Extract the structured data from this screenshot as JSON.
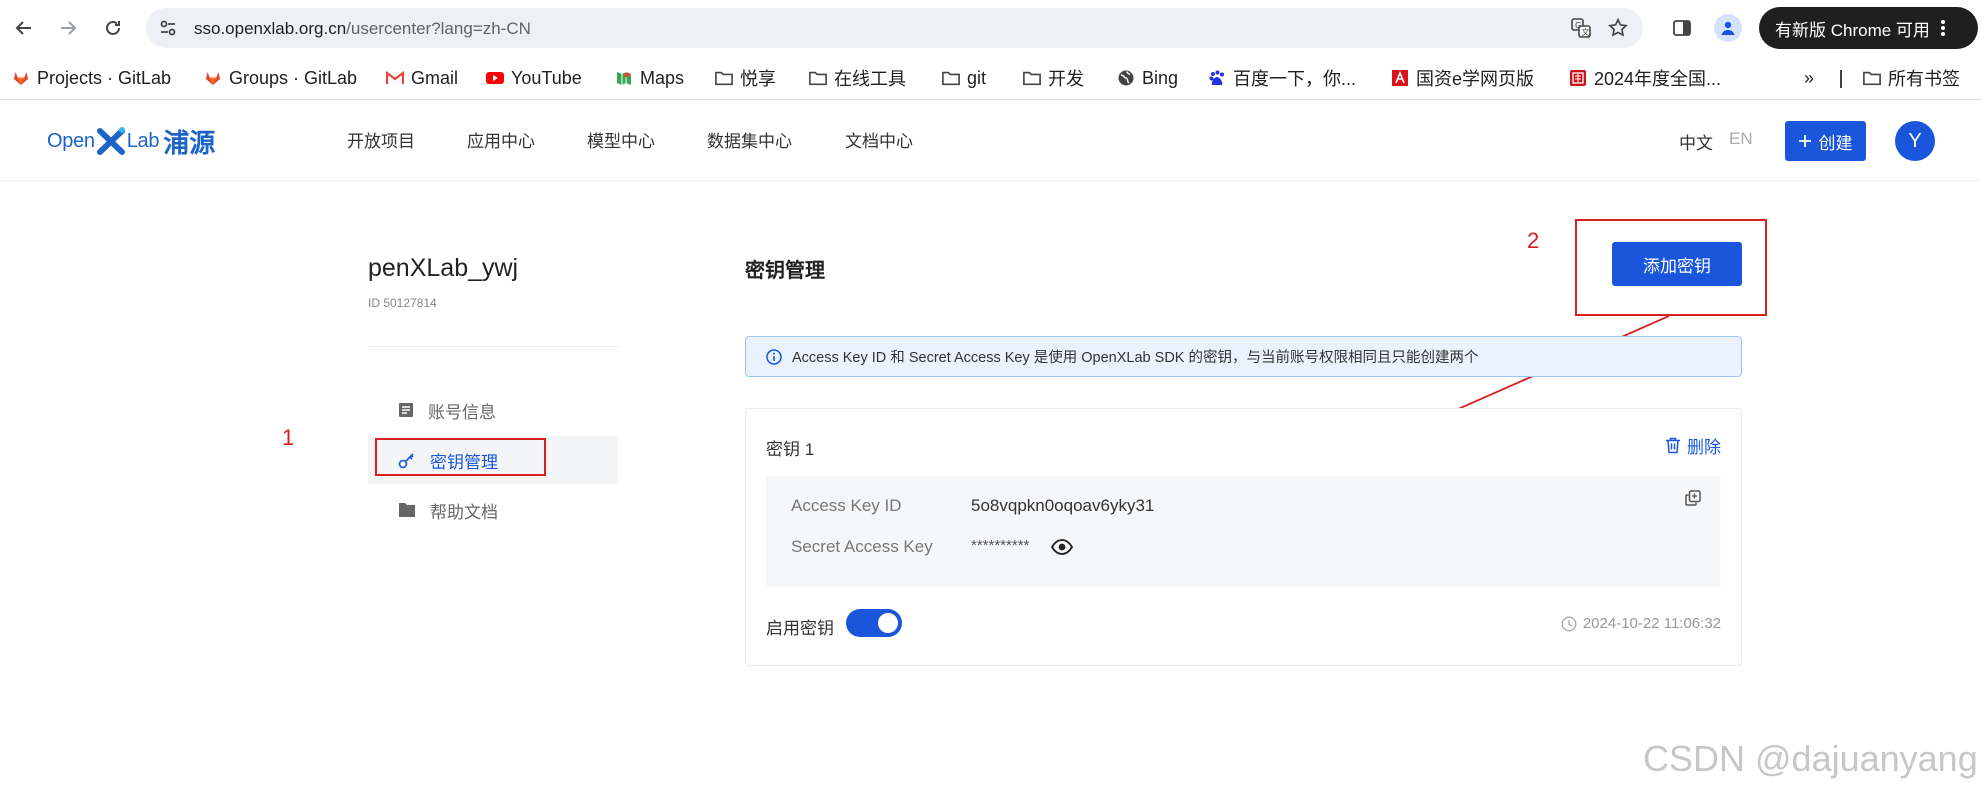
{
  "browser": {
    "url_host": "sso.openxlab.org.cn",
    "url_path": "/usercenter?lang=zh-CN",
    "update_button": "有新版 Chrome 可用",
    "bookmarks": [
      {
        "label": "Projects · GitLab",
        "icon": "gitlab-icon"
      },
      {
        "label": "Groups · GitLab",
        "icon": "gitlab-icon"
      },
      {
        "label": "Gmail",
        "icon": "gmail-icon"
      },
      {
        "label": "YouTube",
        "icon": "youtube-icon"
      },
      {
        "label": "Maps",
        "icon": "maps-icon"
      },
      {
        "label": "悦享",
        "icon": "folder-icon"
      },
      {
        "label": "在线工具",
        "icon": "folder-icon"
      },
      {
        "label": "git",
        "icon": "folder-icon"
      },
      {
        "label": "开发",
        "icon": "folder-icon"
      },
      {
        "label": "Bing",
        "icon": "globe-icon"
      },
      {
        "label": "百度一下，你...",
        "icon": "baidu-icon"
      },
      {
        "label": "国资e学网页版",
        "icon": "adobe-icon"
      },
      {
        "label": "2024年度全国...",
        "icon": "seal-icon"
      }
    ],
    "overflow": "»",
    "all_bookmarks": "所有书签"
  },
  "header": {
    "logo_text_1": "Open",
    "logo_text_2": "Lab",
    "logo_cn": "浦源",
    "nav": [
      "开放项目",
      "应用中心",
      "模型中心",
      "数据集中心",
      "文档中心"
    ],
    "lang_zh": "中文",
    "lang_en": "EN",
    "create_button": "创建",
    "avatar_letter": "Y"
  },
  "sidebar": {
    "username": "penXLab_ywj",
    "user_id": "ID 50127814",
    "items": [
      {
        "label": "账号信息",
        "icon": "id-card-icon",
        "active": false
      },
      {
        "label": "密钥管理",
        "icon": "key-icon",
        "active": true
      },
      {
        "label": "帮助文档",
        "icon": "folder-icon",
        "active": false
      }
    ]
  },
  "annotations": {
    "marker_1": "1",
    "marker_2": "2",
    "color": "#d92020"
  },
  "main": {
    "title": "密钥管理",
    "add_key_button": "添加密钥",
    "info": "Access Key ID 和 Secret Access Key 是使用 OpenXLab SDK 的密钥，与当前账号权限相同且只能创建两个",
    "key_card": {
      "title": "密钥 1",
      "delete_label": "删除",
      "access_key_label": "Access Key ID",
      "access_key_value": "5o8vqpkn0oqoav6yky31",
      "secret_label": "Secret Access Key",
      "secret_value": "**********",
      "enable_label": "启用密钥",
      "enabled": true,
      "created_at": "2024-10-22 11:06:32"
    }
  },
  "watermark": "CSDN @dajuanyang",
  "colors": {
    "primary": "#1a56db",
    "annotation_red": "#d92020",
    "info_bg": "#eaf3fd"
  }
}
